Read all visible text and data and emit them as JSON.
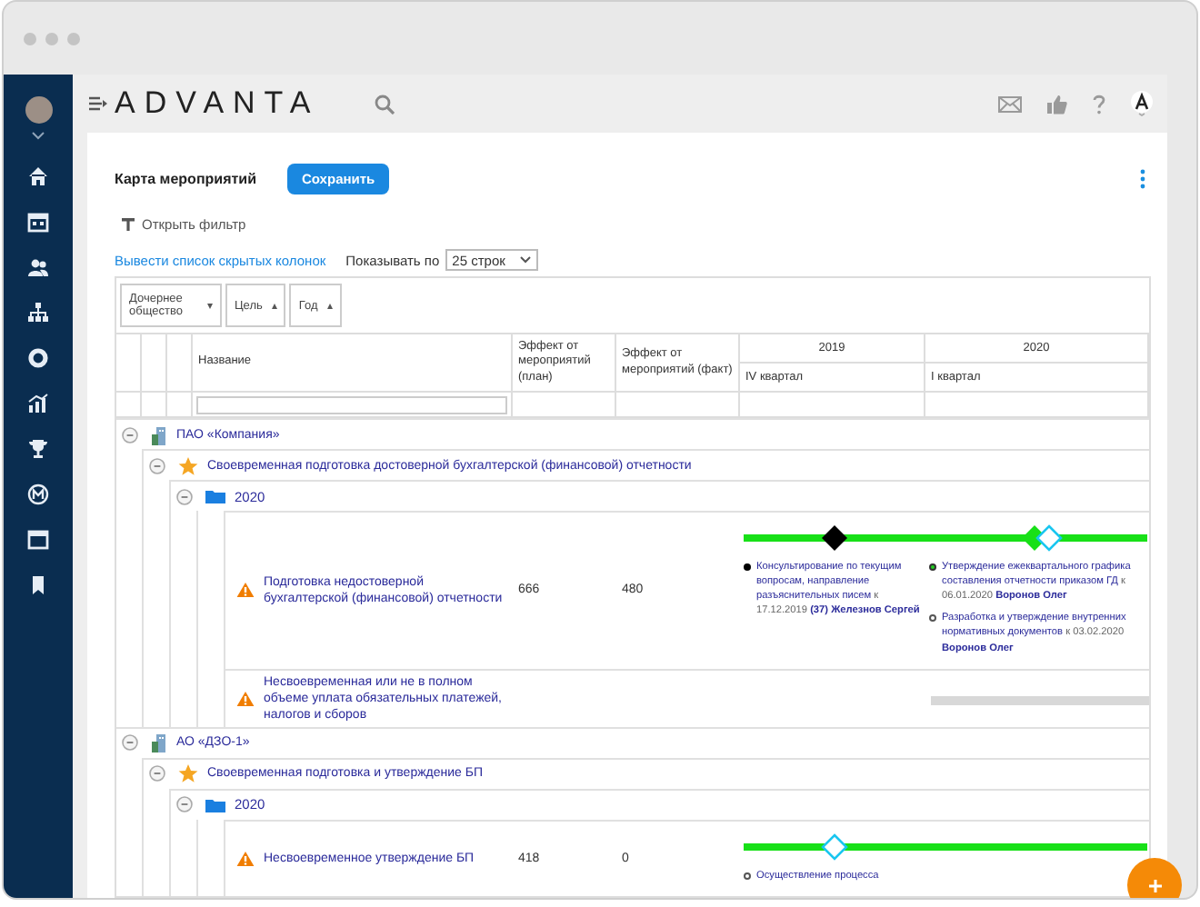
{
  "header": {
    "logo": "ADVANTA"
  },
  "page": {
    "title": "Карта мероприятий",
    "save_button": "Сохранить",
    "filter_toggle": "Открыть фильтр",
    "hidden_columns_link": "Вывести список скрытых колонок",
    "page_size": {
      "label": "Показывать по",
      "value": "25 строк"
    }
  },
  "filters": [
    {
      "label": "Дочернее общество",
      "caret": "▾"
    },
    {
      "label": "Цель",
      "caret": "▴"
    },
    {
      "label": "Год",
      "caret": "▴"
    }
  ],
  "table": {
    "columns": [
      {
        "label": "Название"
      },
      {
        "label": "Эффект от мероприятий (план)"
      },
      {
        "label": "Эффект от мероприятий (факт)"
      }
    ],
    "years": [
      {
        "label": "2019",
        "quarter": "IV квартал"
      },
      {
        "label": "2020",
        "quarter": "I квартал"
      }
    ]
  },
  "tree": [
    {
      "kind": "company",
      "label": "ПАО «Компания»",
      "expanded": true,
      "children": [
        {
          "kind": "goal",
          "label": "Своевременная подготовка достоверной бухгалтерской (финансовой) отчетности",
          "expanded": true,
          "children": [
            {
              "kind": "year",
              "label": "2020",
              "expanded": true,
              "children": [
                {
                  "kind": "risk",
                  "label": "Подготовка недостоверной бухгалтерской (финансовой) отчетности",
                  "plan": "666",
                  "fact": "480",
                  "quarters": [
                    {
                      "milestones": [
                        {
                          "kind": "done",
                          "title": "Консультирование по текущим вопросам, направление разъяснительных писем",
                          "due": "к 17.12.2019",
                          "owner": "(37) Железнов Сергей"
                        }
                      ]
                    },
                    {
                      "milestones": [
                        {
                          "kind": "current",
                          "title": "Утверждение ежеквартального графика составления отчетности приказом ГД",
                          "due": "к 06.01.2020",
                          "owner": "Воронов Олег"
                        },
                        {
                          "kind": "planned",
                          "title": "Разработка и утверждение внутренних нормативных документов",
                          "due": "к 03.02.2020",
                          "owner": "Воронов Олег"
                        }
                      ]
                    }
                  ]
                },
                {
                  "kind": "risk",
                  "label": "Несвоевременная или не в полном объеме уплата обязательных платежей, налогов и сборов"
                }
              ]
            }
          ]
        }
      ]
    },
    {
      "kind": "company",
      "label": "АО «ДЗО-1»",
      "expanded": true,
      "children": [
        {
          "kind": "goal",
          "label": "Своевременная подготовка и утверждение БП",
          "expanded": true,
          "children": [
            {
              "kind": "year",
              "label": "2020",
              "expanded": true,
              "children": [
                {
                  "kind": "risk",
                  "label": "Несвоевременное утверждение БП",
                  "plan": "418",
                  "fact": "0",
                  "quarters": [
                    {
                      "milestones": [
                        {
                          "kind": "planned",
                          "title": "Осуществление процесса"
                        }
                      ]
                    }
                  ]
                }
              ]
            }
          ]
        }
      ]
    }
  ]
}
